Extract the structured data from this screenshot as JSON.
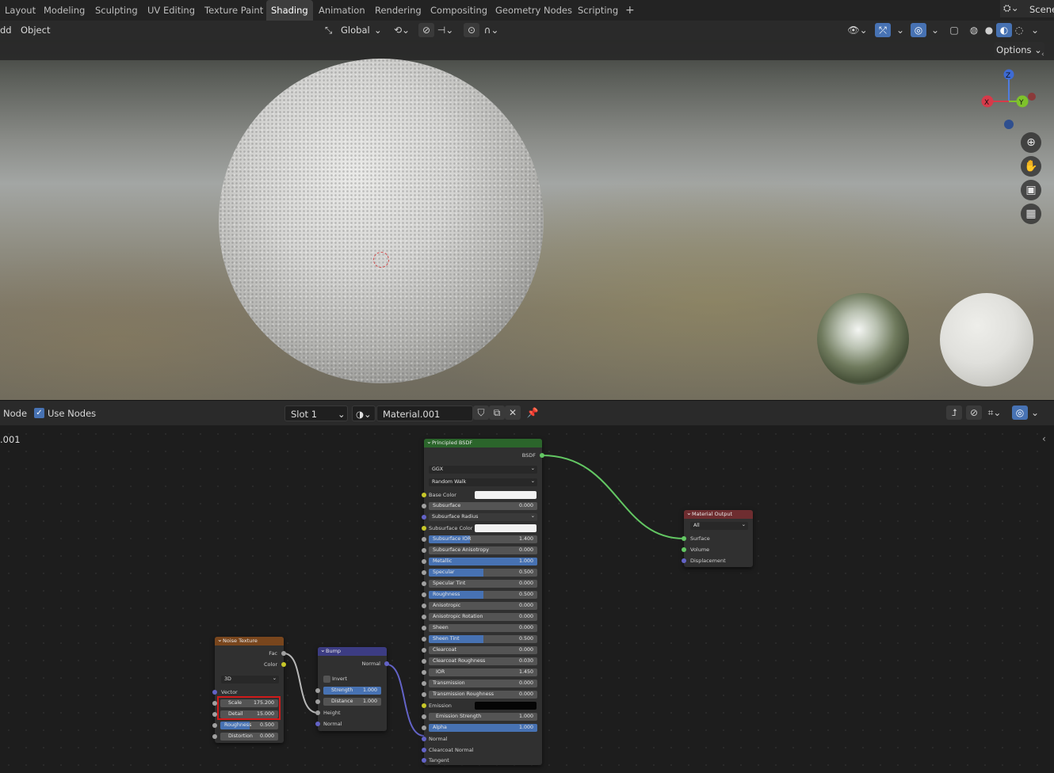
{
  "workspace_tabs": [
    "Layout",
    "Modeling",
    "Sculpting",
    "UV Editing",
    "Texture Paint",
    "Shading",
    "Animation",
    "Rendering",
    "Compositing",
    "Geometry Nodes",
    "Scripting"
  ],
  "active_tab": "Shading",
  "add_tab_symbol": "+",
  "scene_label": "Scene",
  "viewport_header": {
    "add_menu": "dd",
    "object_menu": "Object",
    "orientation": "Global",
    "options_label": "Options"
  },
  "gizmo": {
    "z": "Z",
    "y": "Y",
    "x": "X"
  },
  "node_header": {
    "node_menu": "Node",
    "use_nodes_label": "Use Nodes",
    "use_nodes_checked": true,
    "slot": "Slot 1",
    "material_name": "Material.001",
    "breadcrumb": ".001"
  },
  "noise_texture": {
    "title": "Noise Texture",
    "out_fac": "Fac",
    "out_color": "Color",
    "dimensions": "3D",
    "in_vector": "Vector",
    "scale_label": "Scale",
    "scale_value": "175.200",
    "detail_label": "Detail",
    "detail_value": "15.000",
    "roughness_label": "Roughness",
    "roughness_value": "0.500",
    "distortion_label": "Distortion",
    "distortion_value": "0.000"
  },
  "bump": {
    "title": "Bump",
    "out_normal": "Normal",
    "invert_label": "Invert",
    "strength_label": "Strength",
    "strength_value": "1.000",
    "distance_label": "Distance",
    "distance_value": "1.000",
    "in_height": "Height",
    "in_normal": "Normal"
  },
  "principled": {
    "title": "Principled BSDF",
    "out_bsdf": "BSDF",
    "distribution": "GGX",
    "subsurface_method": "Random Walk",
    "base_color_label": "Base Color",
    "subsurface_label": "Subsurface",
    "subsurface_value": "0.000",
    "subsurface_radius_label": "Subsurface Radius",
    "subsurface_color_label": "Subsurface Color",
    "subsurface_ior_label": "Subsurface IOR",
    "subsurface_ior_value": "1.400",
    "subsurface_aniso_label": "Subsurface Anisotropy",
    "subsurface_aniso_value": "0.000",
    "metallic_label": "Metallic",
    "metallic_value": "1.000",
    "specular_label": "Specular",
    "specular_value": "0.500",
    "specular_tint_label": "Specular Tint",
    "specular_tint_value": "0.000",
    "roughness_label": "Roughness",
    "roughness_value": "0.500",
    "anisotropic_label": "Anisotropic",
    "anisotropic_value": "0.000",
    "aniso_rot_label": "Anisotropic Rotation",
    "aniso_rot_value": "0.000",
    "sheen_label": "Sheen",
    "sheen_value": "0.000",
    "sheen_tint_label": "Sheen Tint",
    "sheen_tint_value": "0.500",
    "clearcoat_label": "Clearcoat",
    "clearcoat_value": "0.000",
    "clearcoat_rough_label": "Clearcoat Roughness",
    "clearcoat_rough_value": "0.030",
    "ior_label": "IOR",
    "ior_value": "1.450",
    "transmission_label": "Transmission",
    "transmission_value": "0.000",
    "trans_rough_label": "Transmission Roughness",
    "trans_rough_value": "0.000",
    "emission_label": "Emission",
    "emission_strength_label": "Emission Strength",
    "emission_strength_value": "1.000",
    "alpha_label": "Alpha",
    "alpha_value": "1.000",
    "normal_label": "Normal",
    "clearcoat_normal_label": "Clearcoat Normal",
    "tangent_label": "Tangent"
  },
  "material_output": {
    "title": "Material Output",
    "target": "All",
    "surface": "Surface",
    "volume": "Volume",
    "displacement": "Displacement"
  },
  "colors": {
    "accent_blue": "#4772b3",
    "shader_header": "#2b652b",
    "texture_header": "#79461d",
    "vector_header": "#3c3c83",
    "output_header": "#6e2d30",
    "highlight_red": "#d11a1a"
  }
}
